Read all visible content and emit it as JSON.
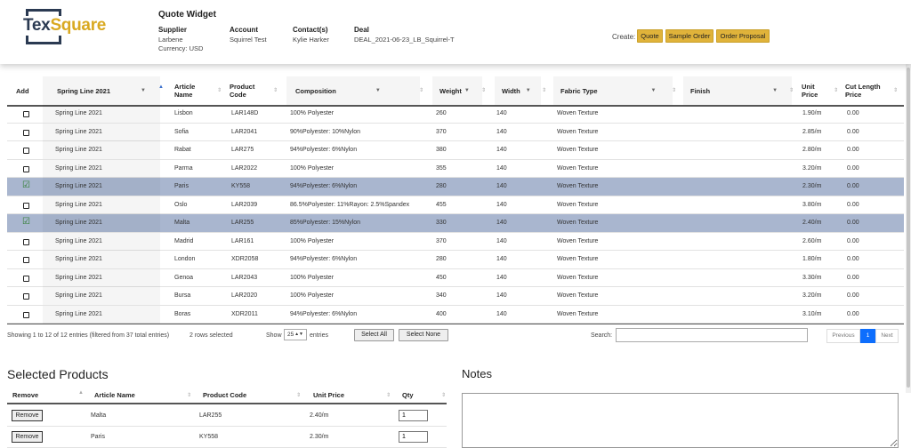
{
  "header": {
    "logo_text_a": "Tex",
    "logo_text_b": "Square",
    "title": "Quote Widget",
    "supplier": {
      "label": "Supplier",
      "name": "Larbene",
      "currency": "Currency: USD"
    },
    "account": {
      "label": "Account",
      "value": "Squirrel Test"
    },
    "contacts": {
      "label": "Contact(s)",
      "value": "Kylie Harker"
    },
    "deal": {
      "label": "Deal",
      "value": "DEAL_2021-06-23_LB_Squirrel-T"
    },
    "create_label": "Create:",
    "create_buttons": [
      "Quote",
      "Sample Order",
      "Order Proposal"
    ]
  },
  "table": {
    "columns": {
      "add": "Add",
      "collection": "Spring Line 2021",
      "article": "Article Name",
      "code": "Product Code",
      "composition": "Composition",
      "weight": "Weight",
      "width": "Width",
      "fabric": "Fabric Type",
      "finish": "Finish",
      "unit_price": "Unit Price",
      "cut_price": "Cut Length Price"
    },
    "rows": [
      {
        "checked": false,
        "collection": "Spring Line 2021",
        "article": "Lisbon",
        "code": "LAR148D",
        "composition": "100% Polyester",
        "weight": "260",
        "width": "140",
        "fabric": "Woven Texture",
        "finish": "",
        "unit_price": "1.90/m",
        "cut_price": "0.00"
      },
      {
        "checked": false,
        "collection": "Spring Line 2021",
        "article": "Sofia",
        "code": "LAR2041",
        "composition": "90%Polyester: 10%Nylon",
        "weight": "370",
        "width": "140",
        "fabric": "Woven Texture",
        "finish": "",
        "unit_price": "2.85/m",
        "cut_price": "0.00"
      },
      {
        "checked": false,
        "collection": "Spring Line 2021",
        "article": "Rabat",
        "code": "LAR275",
        "composition": "94%Polyester: 6%Nylon",
        "weight": "380",
        "width": "140",
        "fabric": "Woven Texture",
        "finish": "",
        "unit_price": "2.80/m",
        "cut_price": "0.00"
      },
      {
        "checked": false,
        "collection": "Spring Line 2021",
        "article": "Parma",
        "code": "LAR2022",
        "composition": "100% Polyester",
        "weight": "355",
        "width": "140",
        "fabric": "Woven Texture",
        "finish": "",
        "unit_price": "3.20/m",
        "cut_price": "0.00"
      },
      {
        "checked": true,
        "collection": "Spring Line 2021",
        "article": "Paris",
        "code": "KY558",
        "composition": "94%Polyester: 6%Nylon",
        "weight": "280",
        "width": "140",
        "fabric": "Woven Texture",
        "finish": "",
        "unit_price": "2.30/m",
        "cut_price": "0.00"
      },
      {
        "checked": false,
        "collection": "Spring Line 2021",
        "article": "Oslo",
        "code": "LAR2039",
        "composition": "86.5%Polyester: 11%Rayon: 2.5%Spandex",
        "weight": "455",
        "width": "140",
        "fabric": "Woven Texture",
        "finish": "",
        "unit_price": "3.80/m",
        "cut_price": "0.00"
      },
      {
        "checked": true,
        "collection": "Spring Line 2021",
        "article": "Malta",
        "code": "LAR255",
        "composition": "85%Polyester: 15%Nylon",
        "weight": "330",
        "width": "140",
        "fabric": "Woven Texture",
        "finish": "",
        "unit_price": "2.40/m",
        "cut_price": "0.00"
      },
      {
        "checked": false,
        "collection": "Spring Line 2021",
        "article": "Madrid",
        "code": "LAR161",
        "composition": "100% Polyester",
        "weight": "370",
        "width": "140",
        "fabric": "Woven Texture",
        "finish": "",
        "unit_price": "2.60/m",
        "cut_price": "0.00"
      },
      {
        "checked": false,
        "collection": "Spring Line 2021",
        "article": "London",
        "code": "XDR2058",
        "composition": "94%Polyester: 6%Nylon",
        "weight": "280",
        "width": "140",
        "fabric": "Woven Texture",
        "finish": "",
        "unit_price": "1.80/m",
        "cut_price": "0.00"
      },
      {
        "checked": false,
        "collection": "Spring Line 2021",
        "article": "Genoa",
        "code": "LAR2043",
        "composition": "100% Polyester",
        "weight": "450",
        "width": "140",
        "fabric": "Woven Texture",
        "finish": "",
        "unit_price": "3.30/m",
        "cut_price": "0.00"
      },
      {
        "checked": false,
        "collection": "Spring Line 2021",
        "article": "Bursa",
        "code": "LAR2020",
        "composition": "100% Polyester",
        "weight": "340",
        "width": "140",
        "fabric": "Woven Texture",
        "finish": "",
        "unit_price": "3.20/m",
        "cut_price": "0.00"
      },
      {
        "checked": false,
        "collection": "Spring Line 2021",
        "article": "Boras",
        "code": "XDR2011",
        "composition": "94%Polyester: 6%Nylon",
        "weight": "400",
        "width": "140",
        "fabric": "Woven Texture",
        "finish": "",
        "unit_price": "3.10/m",
        "cut_price": "0.00"
      }
    ],
    "info": "Showing 1 to 12 of 12 entries (filtered from 37 total entries)",
    "selected_count": "2 rows selected",
    "show_label": "Show",
    "page_length": "25",
    "entries_label": "entries",
    "select_all": "Select All",
    "select_none": "Select None",
    "search_label": "Search:",
    "search_value": "",
    "pagination": {
      "previous": "Previous",
      "current": "1",
      "next": "Next"
    }
  },
  "selected_products": {
    "title": "Selected Products",
    "columns": {
      "remove": "Remove",
      "article": "Article Name",
      "code": "Product Code",
      "unit_price": "Unit Price",
      "qty": "Qty"
    },
    "rows": [
      {
        "button": "Remove",
        "article": "Malta",
        "code": "LAR255",
        "unit_price": "2.40/m",
        "qty": "1"
      },
      {
        "button": "Remove",
        "article": "Paris",
        "code": "KY558",
        "unit_price": "2.30/m",
        "qty": "1"
      }
    ]
  },
  "notes": {
    "title": "Notes",
    "value": ""
  },
  "colors": {
    "selected_row": "#a9b6cf",
    "accent_button": "#e0b33a",
    "pagination_active": "#0d6efd"
  }
}
